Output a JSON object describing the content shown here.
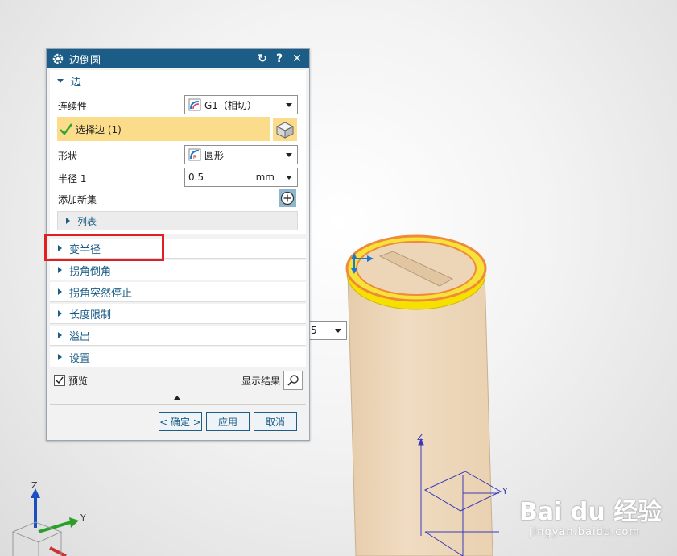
{
  "dialog": {
    "title": "边倒圆",
    "edge_section": {
      "label": "边",
      "continuity_label": "连续性",
      "continuity_value": "G1（相切）",
      "select_edge_label": "选择边 (1)",
      "shape_label": "形状",
      "shape_value": "圆形",
      "radius_label": "半径 1",
      "radius_value": "0.5",
      "radius_unit": "mm",
      "add_set_label": "添加新集",
      "list_label": "列表"
    },
    "sections": [
      {
        "label": "变半径"
      },
      {
        "label": "拐角倒角"
      },
      {
        "label": "拐角突然停止"
      },
      {
        "label": "长度限制"
      },
      {
        "label": "溢出"
      },
      {
        "label": "设置"
      }
    ],
    "preview_label": "预览",
    "preview_checked": true,
    "show_result_label": "显示结果",
    "ok_label": "< 确定 >",
    "apply_label": "应用",
    "cancel_label": "取消"
  },
  "scene": {
    "floating_value": "5",
    "axis_labels": {
      "z": "Z",
      "y": "Y"
    },
    "highlight_color": "#e02020",
    "cylinder_color": "#edd6b8",
    "edge_highlight_color": "#f5e000"
  },
  "watermark": {
    "logo": "Bai du 经验",
    "url": "jingyan.baidu.com"
  }
}
